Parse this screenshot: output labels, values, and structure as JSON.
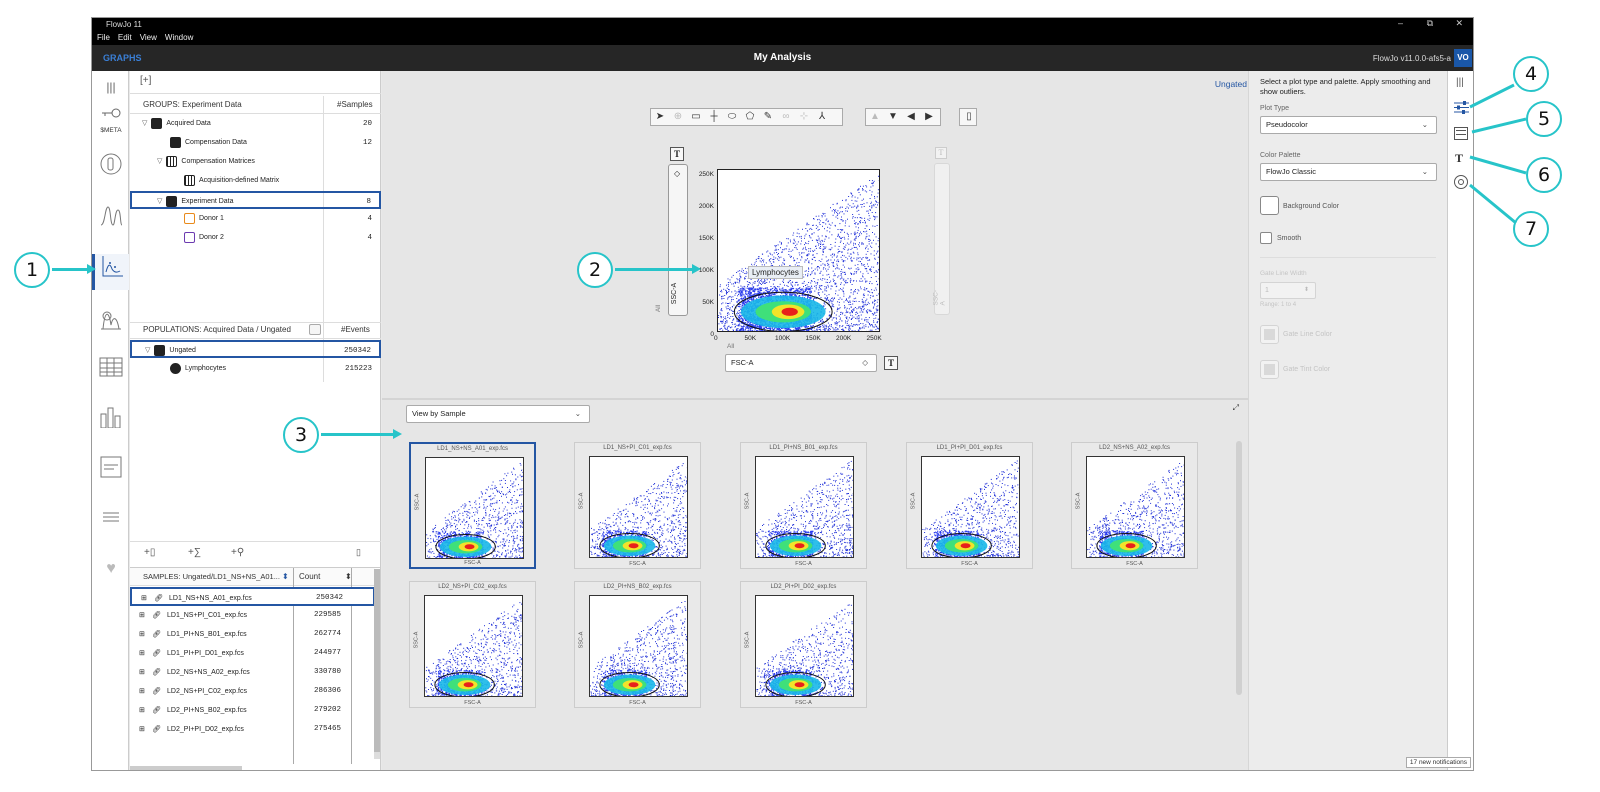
{
  "window": {
    "title": "FlowJo 11",
    "min": "–",
    "restore": "⧉",
    "close": "✕"
  },
  "menu": [
    "File",
    "Edit",
    "View",
    "Window"
  ],
  "appbar": {
    "mode": "GRAPHS",
    "title": "My Analysis",
    "version": "FlowJo v11.0.0-afs5-a",
    "avatar": "VO"
  },
  "leftrail": {
    "meta_label": "$META"
  },
  "groups": {
    "add_label": "[+]",
    "header": "GROUPS: Experiment Data",
    "count_header": "#Samples",
    "items": [
      {
        "label": "Acquired Data",
        "count": "20"
      },
      {
        "label": "Compensation Data",
        "count": "12"
      },
      {
        "label": "Compensation Matrices",
        "count": ""
      },
      {
        "label": "Acquisition-defined Matrix",
        "count": ""
      },
      {
        "label": "Experiment Data",
        "count": "8"
      },
      {
        "label": "Donor 1",
        "count": "4"
      },
      {
        "label": "Donor 2",
        "count": "4"
      }
    ]
  },
  "populations": {
    "header": "POPULATIONS: Acquired Data / Ungated",
    "count_header": "#Events",
    "items": [
      {
        "label": "Ungated",
        "count": "250342"
      },
      {
        "label": "Lymphocytes",
        "count": "215223"
      }
    ]
  },
  "samples": {
    "header": "SAMPLES: Ungated/LD1_NS+NS_A01...",
    "count_header": "Count",
    "rows": [
      {
        "name": "LD1_NS+NS_A01_exp.fcs",
        "count": "250342"
      },
      {
        "name": "LD1_NS+PI_C01_exp.fcs",
        "count": "229585"
      },
      {
        "name": "LD1_PI+NS_B01_exp.fcs",
        "count": "262774"
      },
      {
        "name": "LD1_PI+PI_D01_exp.fcs",
        "count": "244977"
      },
      {
        "name": "LD2_NS+NS_A02_exp.fcs",
        "count": "330780"
      },
      {
        "name": "LD2_NS+PI_C02_exp.fcs",
        "count": "286306"
      },
      {
        "name": "LD2_PI+NS_B02_exp.fcs",
        "count": "279202"
      },
      {
        "name": "LD2_PI+PI_D02_exp.fcs",
        "count": "275465"
      }
    ]
  },
  "main_plot": {
    "ungated_link": "Ungated",
    "gate_label": "Lymphocytes",
    "y_axis": "SSC-A",
    "x_axis": "FSC-A",
    "all_label_y": "All",
    "all_label_x": "All",
    "text_button": "T",
    "y_ticks": [
      "250K",
      "200K",
      "150K",
      "100K",
      "50K",
      "0"
    ],
    "x_ticks": [
      "0",
      "50K",
      "100K",
      "150K",
      "200K",
      "250K"
    ],
    "right_axis": "SSC-A"
  },
  "gallery": {
    "view_by": "View by Sample",
    "thumbs": [
      {
        "title": "LD1_NS+NS_A01_exp.fcs"
      },
      {
        "title": "LD1_NS+PI_C01_exp.fcs"
      },
      {
        "title": "LD1_PI+NS_B01_exp.fcs"
      },
      {
        "title": "LD1_PI+PI_D01_exp.fcs"
      },
      {
        "title": "LD2_NS+NS_A02_exp.fcs"
      },
      {
        "title": "LD2_NS+PI_C02_exp.fcs"
      },
      {
        "title": "LD2_PI+NS_B02_exp.fcs"
      },
      {
        "title": "LD2_PI+PI_D02_exp.fcs"
      }
    ],
    "x_axis": "FSC-A",
    "y_axis": "SSC-A"
  },
  "properties": {
    "intro": "Select a plot type and palette. Apply smoothing and show outliers.",
    "plot_type_label": "Plot Type",
    "plot_type": "Pseudocolor",
    "palette_label": "Color Palette",
    "palette": "FlowJo Classic",
    "background_color": "Background Color",
    "smooth": "Smooth",
    "gate_line_width_label": "Gate Line Width",
    "gate_line_width": "1",
    "range": "Range: 1 to 4",
    "gate_line_color": "Gate Line Color",
    "gate_tint_color": "Gate Tint Color"
  },
  "notifications": "17 new notifications",
  "callouts": [
    "1",
    "2",
    "3",
    "4",
    "5",
    "6",
    "7"
  ],
  "colors": {
    "accent": "#27c4c9",
    "selection": "#2456a3",
    "appbar": "#262626",
    "mode_text": "#3a7fd6"
  }
}
